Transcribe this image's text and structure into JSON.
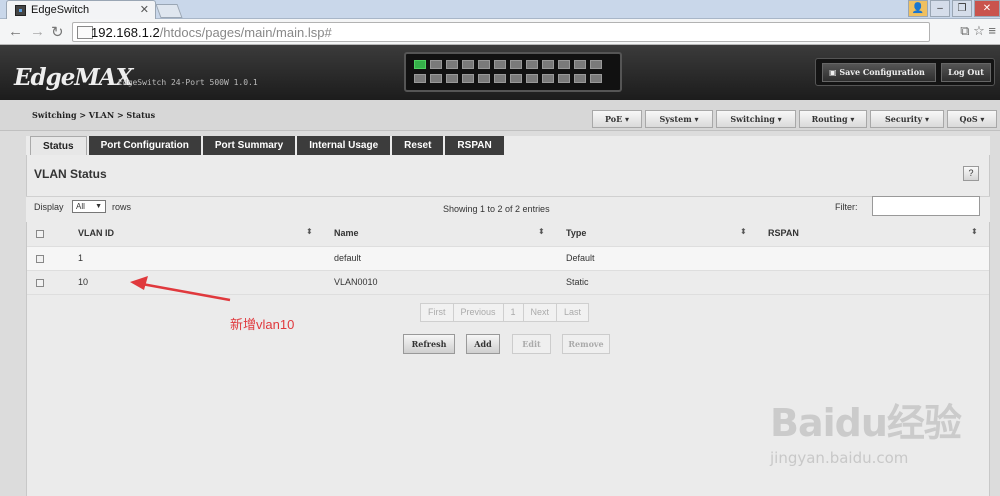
{
  "browser": {
    "tab_title": "EdgeSwitch",
    "url_host": "192.168.1.2",
    "url_path": "/htdocs/pages/main/main.lsp#"
  },
  "device": {
    "logo": "EdgeMAX",
    "name": "EdgeSwitch 24-Port 500W 1.0.1",
    "save_label": "Save Configuration",
    "logout_label": "Log Out"
  },
  "breadcrumb": "Switching > VLAN > Status",
  "menus": [
    "PoE",
    "System",
    "Switching",
    "Routing",
    "Security",
    "QoS"
  ],
  "tabs": [
    "Status",
    "Port Configuration",
    "Port Summary",
    "Internal Usage",
    "Reset",
    "RSPAN"
  ],
  "panel": {
    "title": "VLAN Status",
    "help": "?",
    "display_label": "Display",
    "display_value": "All",
    "rows_label": "rows",
    "showing": "Showing 1 to 2 of 2 entries",
    "filter_label": "Filter:"
  },
  "table": {
    "columns": [
      "VLAN ID",
      "Name",
      "Type",
      "RSPAN"
    ],
    "rows": [
      {
        "id": "1",
        "name": "default",
        "type": "Default",
        "rspan": ""
      },
      {
        "id": "10",
        "name": "VLAN0010",
        "type": "Static",
        "rspan": ""
      }
    ]
  },
  "pager": {
    "first": "First",
    "previous": "Previous",
    "page": "1",
    "next": "Next",
    "last": "Last"
  },
  "actions": {
    "refresh": "Refresh",
    "add": "Add",
    "edit": "Edit",
    "remove": "Remove"
  },
  "annotation": "新增vlan10",
  "watermark": {
    "text": "Baidu经验",
    "url": "jingyan.baidu.com"
  },
  "colors": {
    "annotation": "#e0393d",
    "port_up": "#35b04a",
    "header_bg": "#2a2a2a"
  }
}
